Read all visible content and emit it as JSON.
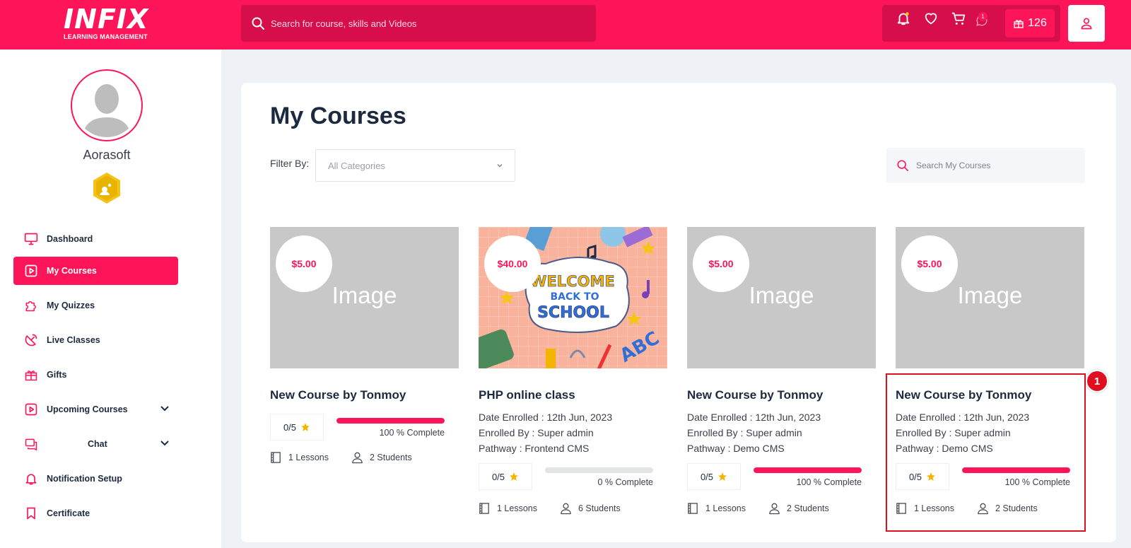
{
  "brand": {
    "name": "INFIX",
    "tagline": "LEARNING MANAGEMENT",
    "accent": "#fd1459"
  },
  "header": {
    "search_placeholder": "Search for course, skills and Videos",
    "notification_badge": "1",
    "points": "126"
  },
  "profile": {
    "name": "Aorasoft"
  },
  "sidebar": {
    "items": [
      {
        "label": "Dashboard",
        "icon": "monitor-icon"
      },
      {
        "label": "My Courses",
        "icon": "play-square-icon",
        "active": true
      },
      {
        "label": "My Quizzes",
        "icon": "puzzle-icon"
      },
      {
        "label": "Live Classes",
        "icon": "satellite-icon"
      },
      {
        "label": "Gifts",
        "icon": "gift-icon"
      },
      {
        "label": "Upcoming Courses",
        "icon": "play-square-icon",
        "expandable": true
      },
      {
        "label": "Chat",
        "icon": "chat-icon",
        "expandable": true
      },
      {
        "label": "Notification Setup",
        "icon": "bell-icon"
      },
      {
        "label": "Certificate",
        "icon": "bookmark-icon"
      }
    ]
  },
  "main": {
    "title": "My Courses",
    "filter_label": "Filter By:",
    "filter_value": "All Categories",
    "search_placeholder": "Search My Courses"
  },
  "courses": [
    {
      "price": "$5.00",
      "image_text": "Image",
      "title": "New Course by Tonmoy",
      "date_enrolled": "",
      "enrolled_by": "",
      "pathway": "",
      "rating": "0/5",
      "progress": 100,
      "progress_label": "100 % Complete",
      "lessons": "1 Lessons",
      "students": "2 Students"
    },
    {
      "price": "$40.00",
      "image_text": "",
      "title": "PHP online class",
      "date_enrolled": "Date Enrolled : 12th Jun, 2023",
      "enrolled_by": "Enrolled By : Super admin",
      "pathway": "Pathway : Frontend CMS",
      "rating": "0/5",
      "progress": 0,
      "progress_label": "0 % Complete",
      "lessons": "1 Lessons",
      "students": "6 Students",
      "banner": {
        "line1": "WELCOME",
        "line2": "BACK TO",
        "line3": "SCHOOL",
        "corner": "ABC"
      }
    },
    {
      "price": "$5.00",
      "image_text": "Image",
      "title": "New Course by Tonmoy",
      "date_enrolled": "Date Enrolled : 12th Jun, 2023",
      "enrolled_by": "Enrolled By : Super admin",
      "pathway": "Pathway : Demo CMS",
      "rating": "0/5",
      "progress": 100,
      "progress_label": "100 % Complete",
      "lessons": "1 Lessons",
      "students": "2 Students"
    },
    {
      "price": "$5.00",
      "image_text": "Image",
      "title": "New Course by Tonmoy",
      "date_enrolled": "Date Enrolled : 12th Jun, 2023",
      "enrolled_by": "Enrolled By : Super admin",
      "pathway": "Pathway : Demo CMS",
      "rating": "0/5",
      "progress": 100,
      "progress_label": "100 % Complete",
      "lessons": "1 Lessons",
      "students": "2 Students"
    }
  ],
  "annotation": {
    "marker": "1"
  }
}
